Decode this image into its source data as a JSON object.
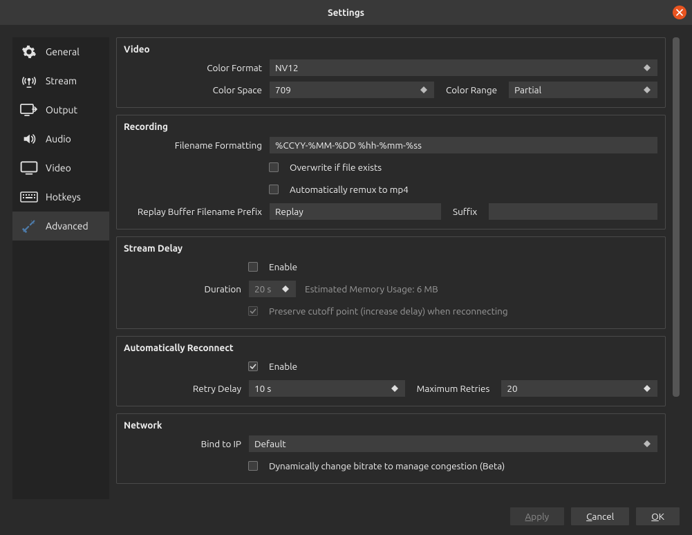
{
  "window": {
    "title": "Settings"
  },
  "sidebar": {
    "items": [
      {
        "label": "General"
      },
      {
        "label": "Stream"
      },
      {
        "label": "Output"
      },
      {
        "label": "Audio"
      },
      {
        "label": "Video"
      },
      {
        "label": "Hotkeys"
      },
      {
        "label": "Advanced"
      }
    ]
  },
  "video": {
    "title": "Video",
    "color_format_label": "Color Format",
    "color_format_value": "NV12",
    "color_space_label": "Color Space",
    "color_space_value": "709",
    "color_range_label": "Color Range",
    "color_range_value": "Partial"
  },
  "recording": {
    "title": "Recording",
    "filename_formatting_label": "Filename Formatting",
    "filename_formatting_value": "%CCYY-%MM-%DD %hh-%mm-%ss",
    "overwrite_label": "Overwrite if file exists",
    "remux_label": "Automatically remux to mp4",
    "replay_prefix_label": "Replay Buffer Filename Prefix",
    "replay_prefix_value": "Replay",
    "suffix_label": "Suffix",
    "suffix_value": ""
  },
  "stream_delay": {
    "title": "Stream Delay",
    "enable_label": "Enable",
    "duration_label": "Duration",
    "duration_value": "20 s",
    "memory_usage": "Estimated Memory Usage: 6 MB",
    "preserve_label": "Preserve cutoff point (increase delay) when reconnecting"
  },
  "reconnect": {
    "title": "Automatically Reconnect",
    "enable_label": "Enable",
    "retry_delay_label": "Retry Delay",
    "retry_delay_value": "10 s",
    "max_retries_label": "Maximum Retries",
    "max_retries_value": "20"
  },
  "network": {
    "title": "Network",
    "bind_to_ip_label": "Bind to IP",
    "bind_to_ip_value": "Default",
    "dyn_bitrate_label": "Dynamically change bitrate to manage congestion (Beta)"
  },
  "footer": {
    "apply": "Apply",
    "cancel": "Cancel",
    "ok": "OK"
  }
}
